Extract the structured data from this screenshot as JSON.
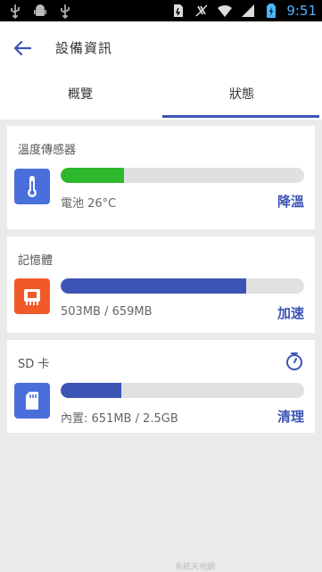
{
  "status_bar": {
    "time": "9:51"
  },
  "app_bar": {
    "title": "設備資訊"
  },
  "tabs": [
    {
      "label": "概覽"
    },
    {
      "label": "狀態"
    }
  ],
  "cards": {
    "temperature": {
      "title": "溫度傳感器",
      "subtitle": "電池 26°C",
      "action": "降溫",
      "level": 0.26,
      "color": "#2eb82e",
      "icon": "thermometer-icon"
    },
    "memory": {
      "title": "記憶體",
      "subtitle": "503MB / 659MB",
      "action": "加速",
      "level": 0.763,
      "color": "#3c54b5",
      "icon": "memory-chip-icon"
    },
    "sd": {
      "title": "SD 卡",
      "subtitle": "內置: 651MB / 2.5GB",
      "action": "清理",
      "level": 0.25,
      "color": "#3c54b5",
      "icon": "sd-card-icon"
    }
  },
  "watermark": "系統天地網"
}
